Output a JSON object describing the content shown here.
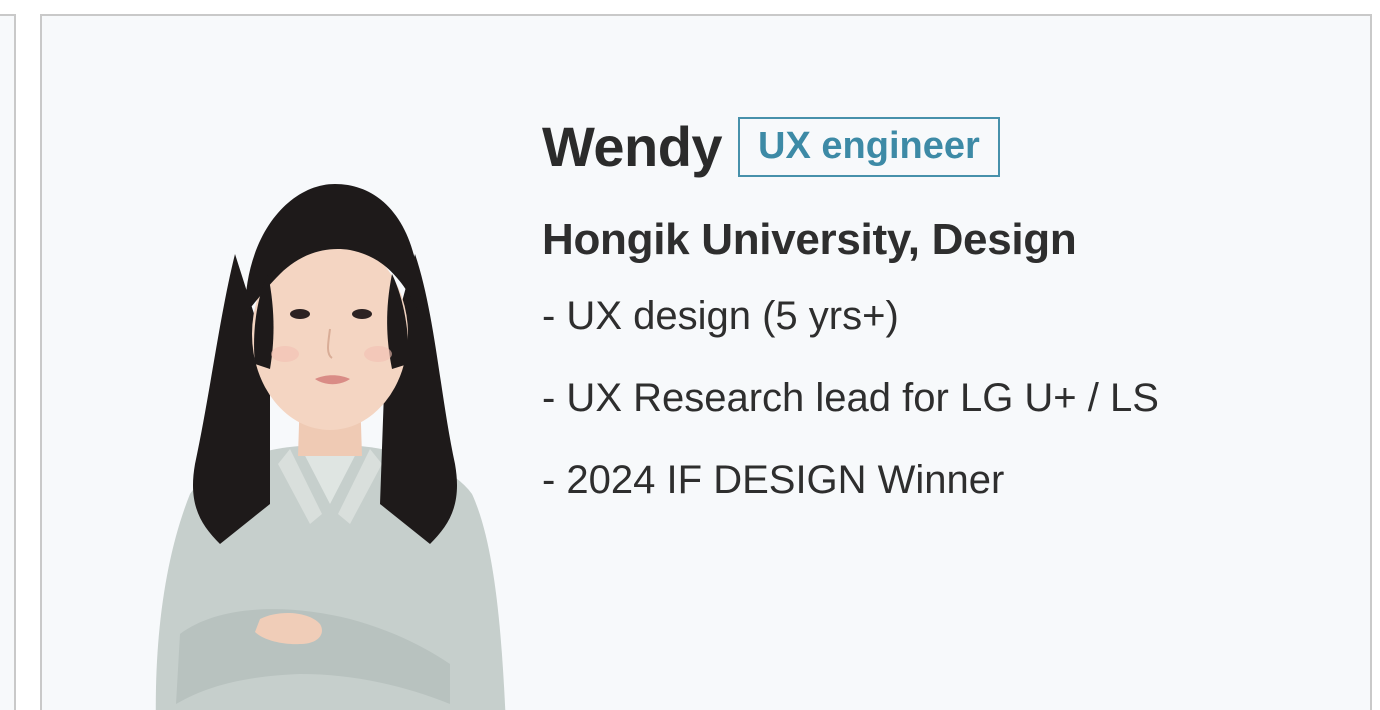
{
  "profile": {
    "name": "Wendy",
    "role": "UX engineer",
    "school": "Hongik University, Design",
    "bullets": [
      "- UX design (5 yrs+)",
      "- UX Research lead for LG U+ / LS",
      "- 2024 IF DESIGN Winner"
    ]
  },
  "colors": {
    "accent": "#3d8aa6",
    "text": "#2e2e2e",
    "card_bg": "#f7f9fb",
    "border": "#c9c9c9"
  },
  "icons": {
    "photo": "profile-photo"
  }
}
